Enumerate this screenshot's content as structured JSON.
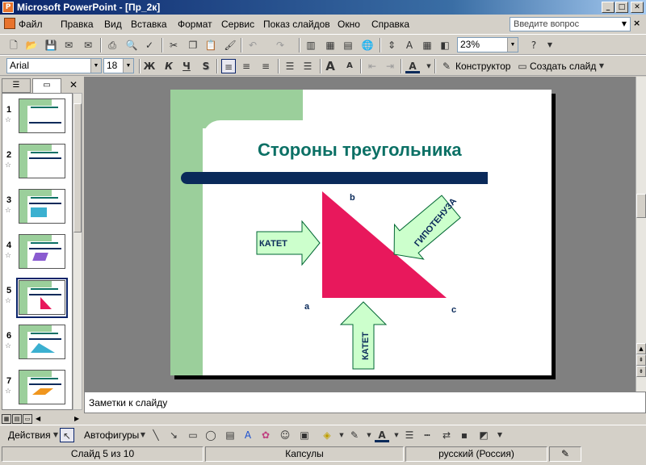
{
  "window": {
    "title": "Microsoft PowerPoint - [Пр_2к]"
  },
  "menu": {
    "items": [
      "Файл",
      "Правка",
      "Вид",
      "Вставка",
      "Формат",
      "Сервис",
      "Показ слайдов",
      "Окно",
      "Справка"
    ],
    "help_placeholder": "Введите вопрос"
  },
  "standard_toolbar": {
    "zoom": "23%"
  },
  "formatting_toolbar": {
    "font": "Arial",
    "size": "18",
    "bold": "Ж",
    "italic": "К",
    "underline": "Ч",
    "shadow": "S",
    "designer": "Конструктор",
    "new_slide": "Создать слайд"
  },
  "slides_panel": {
    "numbers": [
      "1",
      "2",
      "3",
      "4",
      "5",
      "6",
      "7"
    ],
    "selected": "5"
  },
  "slide": {
    "title": "Стороны треугольника",
    "labels": {
      "vertex_a": "a",
      "vertex_b": "b",
      "vertex_c": "c",
      "leg_left": "КАТЕТ",
      "leg_bottom": "КАТЕТ",
      "hypotenuse": "ГИПОТЕНУЗА"
    },
    "colors": {
      "triangle": "#e8185c",
      "arrow_fill": "#ccffcc",
      "arrow_stroke": "#006633",
      "title": "#0b7065",
      "bar": "#0a2a5a",
      "green_frame": "#9bcf9b"
    }
  },
  "notes": {
    "placeholder": "Заметки к слайду"
  },
  "drawing_toolbar": {
    "actions": "Действия",
    "autoshapes": "Автофигуры"
  },
  "status": {
    "slide_of": "Слайд 5 из 10",
    "design": "Капсулы",
    "language": "русский (Россия)"
  }
}
